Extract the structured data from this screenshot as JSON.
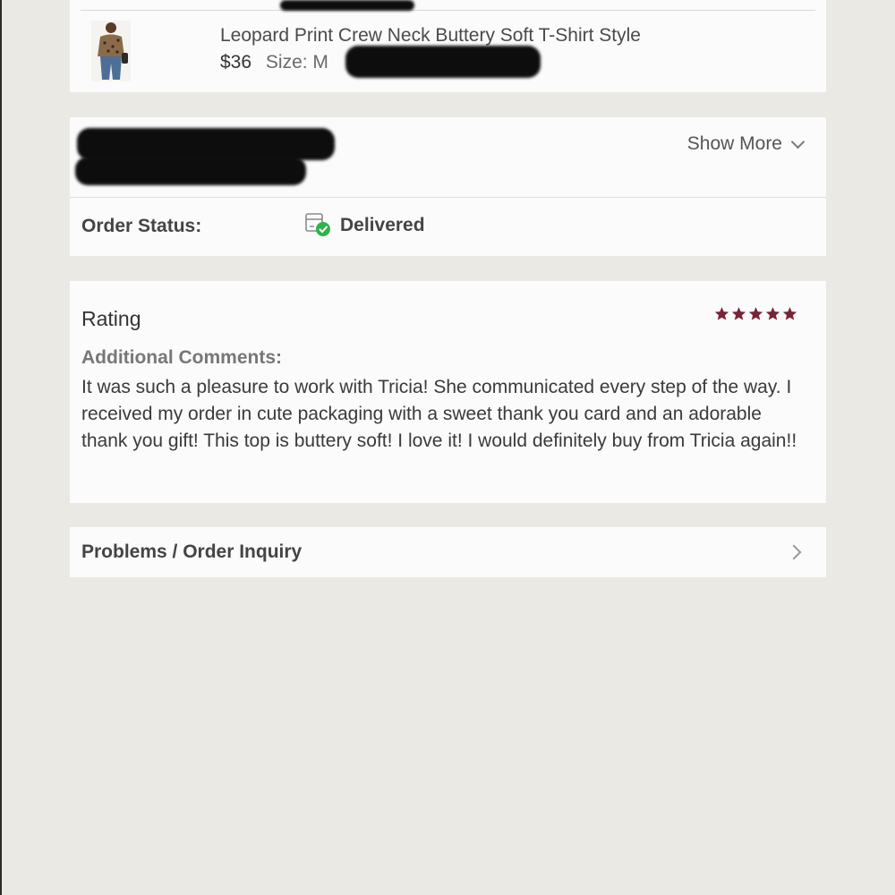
{
  "item": {
    "title": "Leopard Print Crew Neck Buttery Soft T-Shirt Style",
    "price": "$36",
    "size": "Size: M"
  },
  "pricing": {
    "show_more_label": "Show More"
  },
  "order_status": {
    "label": "Order Status:",
    "value": "Delivered",
    "status_color": "#2db34a"
  },
  "rating": {
    "title": "Rating",
    "stars": 5,
    "star_color": "#7a2336",
    "comments_label": "Additional Comments:",
    "comments_text": "It was such a pleasure to work with Tricia! She communicated every step of the way. I received my order in cute packaging with a sweet thank you card and an adorable thank you gift! This top is buttery soft! I love it! I would definitely buy from Tricia again!!"
  },
  "problems": {
    "label": "Problems / Order Inquiry"
  }
}
